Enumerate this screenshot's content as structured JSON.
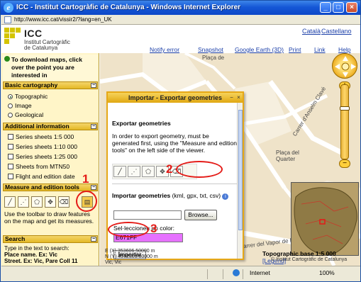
{
  "window": {
    "title": "ICC - Institut Cartogràfic de Catalunya - Windows Internet Explorer",
    "url": "http://www.icc.cat/vissir2/?lang=en_UK",
    "controls": [
      "_",
      "□",
      "×"
    ]
  },
  "header": {
    "logo_name": "ICC",
    "logo_sub1": "Institut Cartogràfic",
    "logo_sub2": "de Catalunya",
    "lang_ca": "Català",
    "lang_es": "Castellano"
  },
  "toolbar_links": {
    "notify": "Notify error",
    "snapshot": "Snapshot",
    "google_earth": "Google Earth (3D)",
    "print": "Print",
    "link": "Link",
    "help": "Help"
  },
  "sidebar": {
    "download_text": "To download maps, click over the point you are interested in",
    "basic_cartography": {
      "title": "Basic cartography",
      "options": [
        "Topographic",
        "Image",
        "Geological"
      ],
      "selected": "Topographic"
    },
    "additional_info": {
      "title": "Additional information",
      "items": [
        "Series sheets 1:5 000",
        "Series sheets 1:10 000",
        "Series sheets 1:25 000",
        "Sheets from MTN50",
        "Flight and edition date"
      ]
    },
    "measure": {
      "title": "Measure and edition tools",
      "text": "Use the toolbar to draw features on the map and get its measures."
    },
    "search": {
      "title": "Search",
      "line1": "Type in the text to search:",
      "line2": "Place name. Ex: Vic",
      "line3": "Street. Ex: Vic, Pare Coll 11"
    }
  },
  "dialog": {
    "title": "Importar - Exportar geometries",
    "export_title": "Exportar geometries",
    "export_text": "In order to export geometry, must be generated first, using the \"Measure and edition tools\" on the left side of the viewer.",
    "import_title": "Importar geometries",
    "import_formats": "(kml, gpx, txt, csv)",
    "browse_label": "Browse...",
    "color_label": "Sel·leccioneu un color:",
    "color_value": "E671FF",
    "import_button": "Importar"
  },
  "annotations": [
    "1",
    "2",
    "3"
  ],
  "map": {
    "labels": [
      "Plaça de",
      "Plaça del",
      "Quarter",
      "Carrer d'Anselm Clavé",
      "Carrer del Vapor de M"
    ],
    "coords_x": "E (X) 353606.50000 m",
    "coords_y": "N (Y) 4572305.00000 m",
    "coords_place": "Vic, Vic",
    "scale_label": "Topographic base 1:5 000",
    "legend": "[Legend]",
    "copyright": "© Institut Cartogràfic de Catalunya"
  },
  "statusbar": {
    "zone": "Internet",
    "zoom": "100%"
  },
  "colors": {
    "section_header": "#e4b825",
    "sidebar_bg": "#fff5c8",
    "annotation_red": "#e41b17",
    "picked_color": "#e671ff"
  }
}
